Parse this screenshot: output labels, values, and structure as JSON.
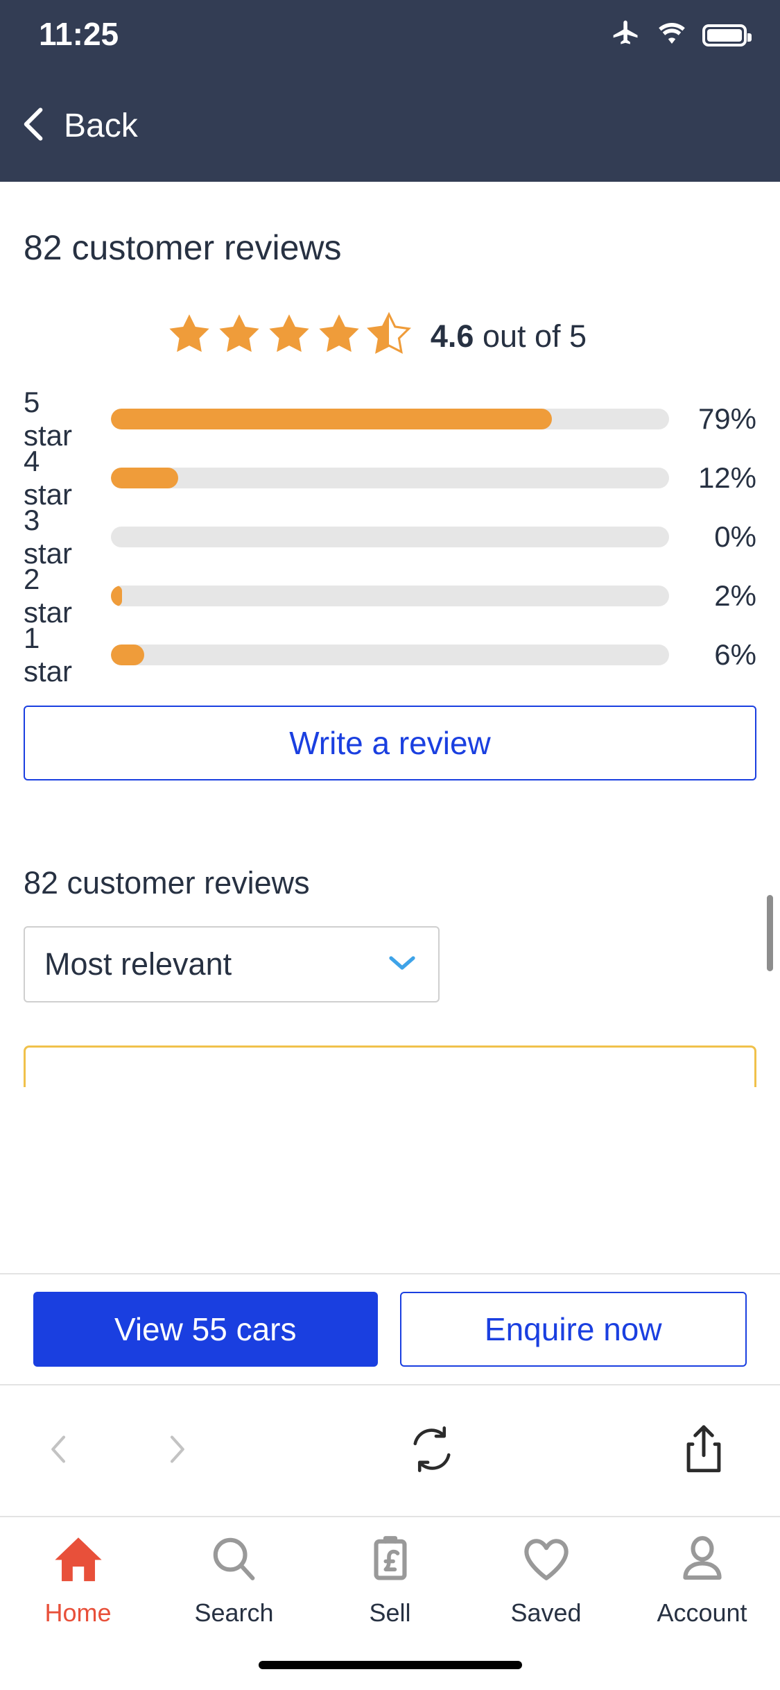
{
  "status_bar": {
    "time": "11:25",
    "icons": [
      "airplane-icon",
      "wifi-icon",
      "battery-icon"
    ]
  },
  "nav": {
    "back_label": "Back",
    "back_icon": "chevron-left-icon"
  },
  "header": {
    "title": "82 customer reviews"
  },
  "rating_summary": {
    "stars_filled": 4.5,
    "score": "4.6",
    "score_suffix": " out of 5",
    "star_color": "#ef9c3a"
  },
  "chart_data": {
    "type": "bar",
    "title": "Rating distribution",
    "categories": [
      "5 star",
      "4 star",
      "3 star",
      "2 star",
      "1 star"
    ],
    "values": [
      79,
      12,
      0,
      2,
      6
    ],
    "value_labels": [
      "79%",
      "12%",
      "0%",
      "2%",
      "6%"
    ],
    "xlabel": "",
    "ylabel": "",
    "xlim": [
      0,
      100
    ],
    "grid": false,
    "orientation": "horizontal",
    "bar_color": "#ef9c3a",
    "track_color": "#e6e6e6"
  },
  "write_review": {
    "label": "Write a review"
  },
  "reviews_section": {
    "title": "82 customer reviews",
    "sort": {
      "selected": "Most relevant",
      "chevron_icon": "chevron-down-icon"
    }
  },
  "cta": {
    "primary_label": "View 55 cars",
    "secondary_label": "Enquire now",
    "primary_color": "#1a3fe0"
  },
  "browser_toolbar": {
    "items": [
      {
        "icon": "back-arrow-icon",
        "enabled": false
      },
      {
        "icon": "forward-arrow-icon",
        "enabled": false
      },
      {
        "icon": "reload-icon",
        "enabled": true
      },
      {
        "icon": "share-icon",
        "enabled": true
      }
    ]
  },
  "tabbar": {
    "items": [
      {
        "label": "Home",
        "icon": "home-icon",
        "active": true
      },
      {
        "label": "Search",
        "icon": "search-icon",
        "active": false
      },
      {
        "label": "Sell",
        "icon": "pound-tag-icon",
        "active": false
      },
      {
        "label": "Saved",
        "icon": "heart-icon",
        "active": false
      },
      {
        "label": "Account",
        "icon": "person-icon",
        "active": false
      }
    ],
    "active_color": "#e8503a",
    "inactive_color": "#999999"
  }
}
